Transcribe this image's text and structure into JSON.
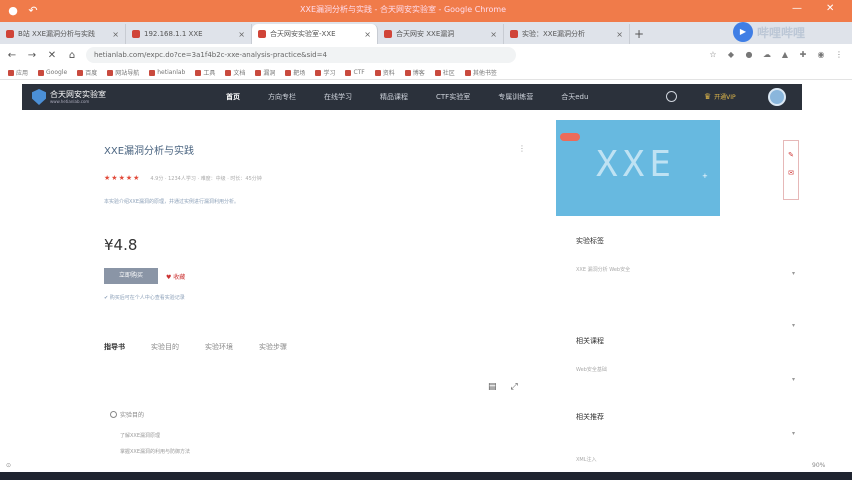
{
  "browser": {
    "titlebar_text": "XXE漏洞分析与实践 - 合天网安实验室 - Google Chrome",
    "tabs": [
      {
        "label": "B站 XXE漏洞分析与实践"
      },
      {
        "label": "192.168.1.1 XXE"
      },
      {
        "label": "合天网安实验室-XXE"
      },
      {
        "label": "合天网安 XXE漏洞"
      },
      {
        "label": "实验：XXE漏洞分析"
      },
      {
        "label": "合天网安实验室"
      }
    ],
    "address": "hetianlab.com/expc.do?ce=3a1f4b2c-xxe-analysis-practice&sid=4",
    "bookmarks": [
      "应用",
      "Google",
      "百度",
      "网站导航",
      "hetianlab",
      "工具",
      "文档",
      "漏洞",
      "靶场",
      "学习",
      "CTF",
      "资料",
      "博客",
      "社区",
      "其他书签"
    ]
  },
  "player_overlay": "哔哩哔哩",
  "site": {
    "logo_title": "合天网安实验室",
    "logo_sub": "www.hetianlab.com",
    "nav": [
      "首页",
      "方向专栏",
      "在线学习",
      "精品课程",
      "CTF实验室",
      "专属训练营",
      "合天edu"
    ],
    "vip_label": "开通VIP"
  },
  "course": {
    "title": "XXE漏洞分析与实践",
    "stars": 5,
    "rating_meta": "4.9分 · 1234人学习 · 难度：中级 · 时长：45分钟",
    "description": "本实验介绍XXE漏洞的原理，并通过实例进行漏洞利用分析。",
    "price": "¥4.8",
    "buy_label": "立即购买",
    "fav_label": "收藏",
    "notice": "购买后可在个人中心查看实验记录"
  },
  "content_tabs": [
    "指导书",
    "实验目的",
    "实验环境",
    "实验步骤"
  ],
  "guide": {
    "section_title": "实验目的",
    "lines": [
      "了解XXE漏洞原理",
      "掌握XXE漏洞的利用与防御方法"
    ]
  },
  "sidebar": {
    "sections": [
      {
        "title": "实验标签",
        "line": "XXE  漏洞分析  Web安全"
      },
      {
        "title": "相关课程",
        "line": "Web安全基础"
      },
      {
        "title": "相关推荐",
        "line": "XML注入"
      }
    ]
  },
  "zoom": "90%"
}
